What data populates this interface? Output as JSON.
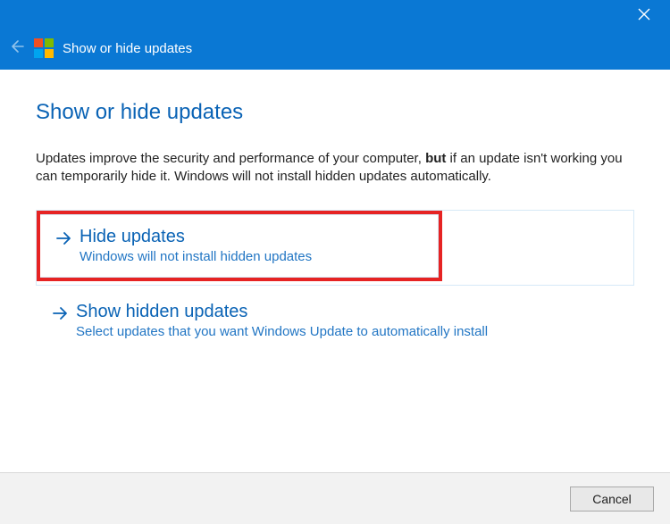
{
  "titlebar": {
    "title": "Show or hide updates"
  },
  "page": {
    "heading": "Show or hide updates",
    "intro_plain": "Updates improve the security and performance of your computer, ",
    "intro_bold": "but",
    "intro_tail": " if an update isn't working you can temporarily hide it. Windows will not install hidden updates automatically."
  },
  "options": [
    {
      "title": "Hide updates",
      "desc": "Windows will not install hidden updates",
      "highlighted": true
    },
    {
      "title": "Show hidden updates",
      "desc": "Select updates that you want Windows Update to automatically install",
      "highlighted": false
    }
  ],
  "footer": {
    "cancel": "Cancel"
  }
}
